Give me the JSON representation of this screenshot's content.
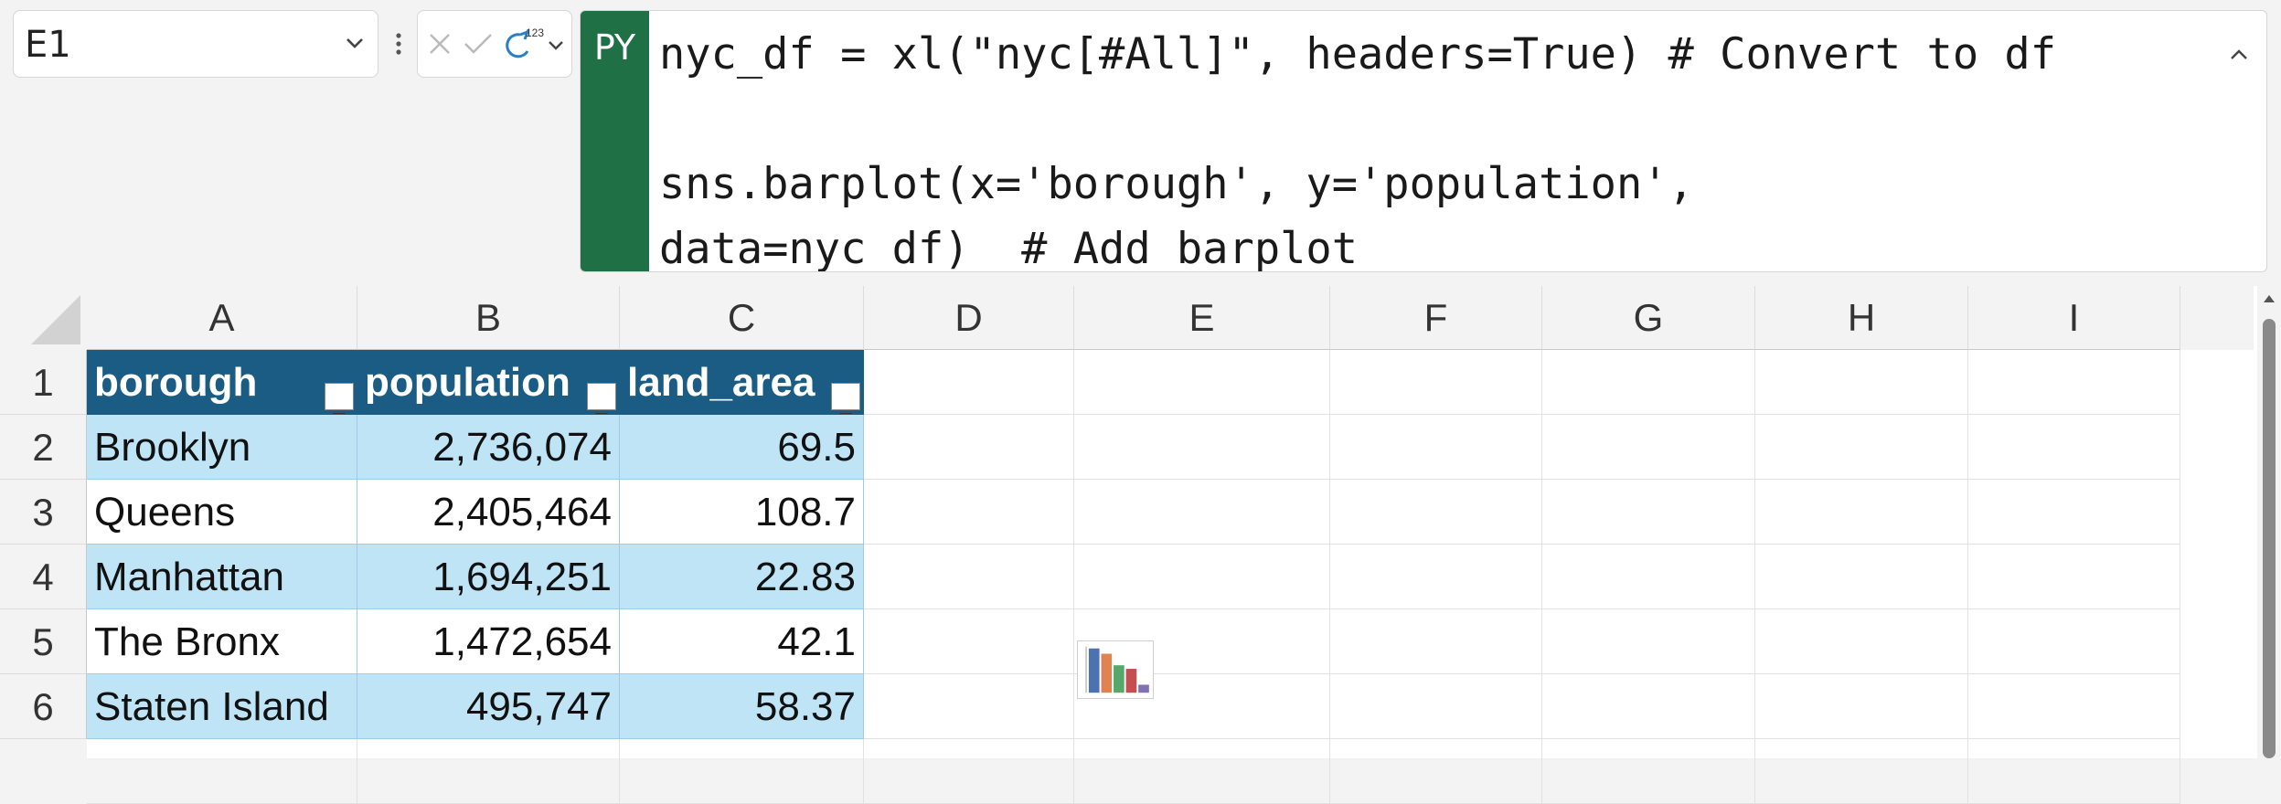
{
  "name_box": {
    "value": "E1"
  },
  "formula_bar": {
    "language_badge": "PY",
    "code_lines": [
      "nyc_df = xl(\"nyc[#All]\", headers=True) # Convert to df",
      "",
      "sns.barplot(x='borough', y='population',",
      "data=nyc_df)  # Add barplot"
    ],
    "output_type_label": "123"
  },
  "columns": [
    "A",
    "B",
    "C",
    "D",
    "E",
    "F",
    "G",
    "H",
    "I"
  ],
  "rows": [
    "1",
    "2",
    "3",
    "4",
    "5",
    "6"
  ],
  "table": {
    "headers": [
      "borough",
      "population",
      "land_area"
    ],
    "rows": [
      [
        "Brooklyn",
        "2,736,074",
        "69.5"
      ],
      [
        "Queens",
        "2,405,464",
        "108.7"
      ],
      [
        "Manhattan",
        "1,694,251",
        "22.83"
      ],
      [
        "The Bronx",
        "1,472,654",
        "42.1"
      ],
      [
        "Staten Island",
        "495,747",
        "58.37"
      ]
    ]
  },
  "chart_thumbnail": {
    "cell": "E1",
    "type": "bar",
    "colors": [
      "#4c72b0",
      "#dd8452",
      "#55a868",
      "#c44e52",
      "#8172b3"
    ],
    "relative_heights": [
      1.0,
      0.88,
      0.62,
      0.54,
      0.18
    ]
  },
  "colors": {
    "python_badge": "#1f7145",
    "table_header": "#1a5c84",
    "table_band": "#bfe4f6"
  }
}
